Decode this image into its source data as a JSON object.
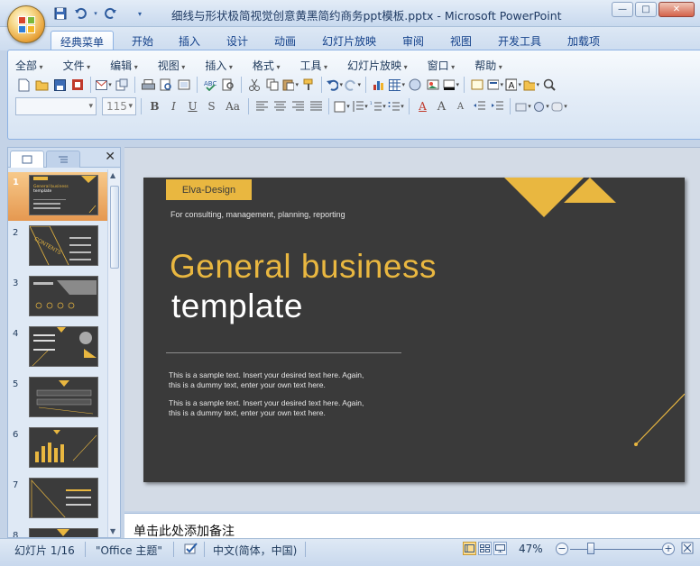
{
  "window": {
    "title": "细线与形状极简视觉创意黄黑简约商务ppt模板.pptx - Microsoft PowerPoint",
    "minimize": "—",
    "maximize": "□",
    "close": "✕"
  },
  "quick_access": [
    "save-icon",
    "undo-icon",
    "redo-icon",
    "customize-icon"
  ],
  "tabs": [
    {
      "label": "经典菜单",
      "active": true
    },
    {
      "label": "开始"
    },
    {
      "label": "插入"
    },
    {
      "label": "设计"
    },
    {
      "label": "动画"
    },
    {
      "label": "幻灯片放映"
    },
    {
      "label": "审阅"
    },
    {
      "label": "视图"
    },
    {
      "label": "开发工具"
    },
    {
      "label": "加载项"
    }
  ],
  "menus": [
    "全部",
    "文件",
    "编辑",
    "视图",
    "插入",
    "格式",
    "工具",
    "幻灯片放映",
    "窗口",
    "帮助"
  ],
  "format_bar": {
    "font_name": "",
    "font_size": "115",
    "bold": "B",
    "italic": "I",
    "underline": "U",
    "shadow": "S",
    "case": "Aa",
    "font_color": "A",
    "grow": "A",
    "shrink": "A"
  },
  "slides_panel": {
    "close": "✕",
    "slide_numbers": [
      "1",
      "2",
      "3",
      "4",
      "5",
      "6",
      "7",
      "8"
    ],
    "selected": 1,
    "thumb_texts": {
      "s1_title": "General business template",
      "s2_title": "CONTENTS"
    }
  },
  "slide": {
    "brand": "Elva-Design",
    "tagline": "For consulting, management, planning, reporting",
    "title_line1": "General business",
    "title_line2": "template",
    "body1_line1": "This is a sample text. Insert your desired text here. Again,",
    "body1_line2": "this is a dummy text, enter your own text here.",
    "body2_line1": "This is a sample text. Insert your desired text here. Again,",
    "body2_line2": "this is a dummy text, enter your own text here.",
    "colors": {
      "background": "#3a3a3a",
      "accent": "#e9b740",
      "text": "#ffffff"
    }
  },
  "notes": {
    "placeholder": "单击此处添加备注"
  },
  "status": {
    "slide_info": "幻灯片 1/16",
    "theme": "\"Office 主题\"",
    "language": "中文(简体，中国)",
    "zoom": "47%",
    "zoom_out": "−",
    "zoom_in": "+"
  }
}
